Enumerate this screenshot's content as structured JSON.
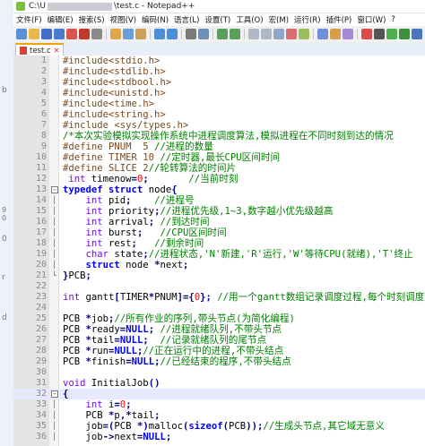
{
  "window": {
    "title_prefix": "C:\\U",
    "title_suffix": "\\test.c - Notepad++",
    "menu": [
      "文件(F)",
      "编辑(E)",
      "搜索(S)",
      "视图(V)",
      "编码(N)",
      "语言(L)",
      "设置(T)",
      "工具(O)",
      "宏(M)",
      "运行(R)",
      "插件(P)",
      "窗口(W)",
      "?"
    ]
  },
  "tab": {
    "label": "test.c"
  },
  "left_strip_marks": [
    "b",
    "9 0",
    "0",
    "r",
    "d"
  ],
  "lines": [
    {
      "n": "1",
      "fold": "",
      "cur": false,
      "seg": [
        [
          "pp",
          "#include<stdio.h>"
        ]
      ]
    },
    {
      "n": "2",
      "fold": "",
      "cur": false,
      "seg": [
        [
          "pp",
          "#include<stdlib.h>"
        ]
      ]
    },
    {
      "n": "3",
      "fold": "",
      "cur": false,
      "seg": [
        [
          "pp",
          "#include<stdbool.h>"
        ]
      ]
    },
    {
      "n": "4",
      "fold": "",
      "cur": false,
      "seg": [
        [
          "pp",
          "#include<unistd.h>"
        ]
      ]
    },
    {
      "n": "5",
      "fold": "",
      "cur": false,
      "seg": [
        [
          "pp",
          "#include<time.h>"
        ]
      ]
    },
    {
      "n": "6",
      "fold": "",
      "cur": false,
      "seg": [
        [
          "pp",
          "#include<string.h>"
        ]
      ]
    },
    {
      "n": "7",
      "fold": "",
      "cur": false,
      "seg": [
        [
          "pp",
          "#include <sys/types.h>"
        ]
      ]
    },
    {
      "n": "8",
      "fold": "",
      "cur": false,
      "seg": [
        [
          "cm",
          "/*本次实验模拟实现操作系统中进程调度算法,模拟进程在不同时刻到达的情况"
        ]
      ]
    },
    {
      "n": "9",
      "fold": "",
      "cur": false,
      "seg": [
        [
          "pp",
          "#define PNUM  5 "
        ],
        [
          "cm",
          "//进程的数量"
        ]
      ]
    },
    {
      "n": "10",
      "fold": "",
      "cur": false,
      "seg": [
        [
          "pp",
          "#define TIMER 10 "
        ],
        [
          "cm",
          "//定时器,最长CPU区间时间"
        ]
      ]
    },
    {
      "n": "11",
      "fold": "",
      "cur": false,
      "seg": [
        [
          "pp",
          "#define SLICE 2"
        ],
        [
          "cm",
          "//轮转算法的时间片"
        ]
      ]
    },
    {
      "n": "12",
      "fold": "",
      "cur": false,
      "seg": [
        [
          "id",
          " "
        ],
        [
          "ty",
          "int"
        ],
        [
          "id",
          " timenow"
        ],
        [
          "op",
          "="
        ],
        [
          "nm",
          "0"
        ],
        [
          "op",
          ";"
        ],
        [
          "cm",
          "       //当前时刻"
        ]
      ]
    },
    {
      "n": "13",
      "fold": "box",
      "cur": false,
      "seg": [
        [
          "kw",
          "typedef"
        ],
        [
          "id",
          " "
        ],
        [
          "kw",
          "struct"
        ],
        [
          "id",
          " node"
        ],
        [
          "op",
          "{"
        ]
      ]
    },
    {
      "n": "14",
      "fold": "line",
      "cur": false,
      "seg": [
        [
          "id",
          "    "
        ],
        [
          "ty",
          "int"
        ],
        [
          "id",
          " pid"
        ],
        [
          "op",
          ";"
        ],
        [
          "cm",
          "    //进程号"
        ]
      ]
    },
    {
      "n": "15",
      "fold": "line",
      "cur": false,
      "seg": [
        [
          "id",
          "    "
        ],
        [
          "ty",
          "int"
        ],
        [
          "id",
          " priority"
        ],
        [
          "op",
          ";"
        ],
        [
          "cm",
          "//进程优先级,1~3,数字越小优先级越高"
        ]
      ]
    },
    {
      "n": "16",
      "fold": "line",
      "cur": false,
      "seg": [
        [
          "id",
          "    "
        ],
        [
          "ty",
          "int"
        ],
        [
          "id",
          " arrival"
        ],
        [
          "op",
          ";"
        ],
        [
          "cm",
          " //到达时间"
        ]
      ]
    },
    {
      "n": "17",
      "fold": "line",
      "cur": false,
      "seg": [
        [
          "id",
          "    "
        ],
        [
          "ty",
          "int"
        ],
        [
          "id",
          " burst"
        ],
        [
          "op",
          ";"
        ],
        [
          "cm",
          "   //CPU区间时间"
        ]
      ]
    },
    {
      "n": "18",
      "fold": "line",
      "cur": false,
      "seg": [
        [
          "id",
          "    "
        ],
        [
          "ty",
          "int"
        ],
        [
          "id",
          " rest"
        ],
        [
          "op",
          ";"
        ],
        [
          "cm",
          "   //剩余时间"
        ]
      ]
    },
    {
      "n": "19",
      "fold": "line",
      "cur": false,
      "seg": [
        [
          "id",
          "    "
        ],
        [
          "ty",
          "char"
        ],
        [
          "id",
          " state"
        ],
        [
          "op",
          ";"
        ],
        [
          "cm",
          "//进程状态,'N'新建,'R'运行,'W'等待CPU(就绪),'T'终止"
        ]
      ]
    },
    {
      "n": "20",
      "fold": "line",
      "cur": false,
      "seg": [
        [
          "id",
          "    "
        ],
        [
          "kw",
          "struct"
        ],
        [
          "id",
          " node "
        ],
        [
          "op",
          "*"
        ],
        [
          "id",
          "next"
        ],
        [
          "op",
          ";"
        ]
      ]
    },
    {
      "n": "21",
      "fold": "end",
      "cur": false,
      "seg": [
        [
          "op",
          "}"
        ],
        [
          "id",
          "PCB"
        ],
        [
          "op",
          ";"
        ]
      ]
    },
    {
      "n": "22",
      "fold": "",
      "cur": false,
      "seg": []
    },
    {
      "n": "23",
      "fold": "",
      "cur": false,
      "seg": [
        [
          "ty",
          "int"
        ],
        [
          "id",
          " gantt"
        ],
        [
          "op",
          "["
        ],
        [
          "id",
          "TIMER"
        ],
        [
          "op",
          "*"
        ],
        [
          "id",
          "PNUM"
        ],
        [
          "op",
          "]={"
        ],
        [
          "nm",
          "0"
        ],
        [
          "op",
          "};"
        ],
        [
          "cm",
          " //用一个gantt数组记录调度过程,每个时刻调度"
        ]
      ]
    },
    {
      "n": "24",
      "fold": "",
      "cur": false,
      "seg": []
    },
    {
      "n": "25",
      "fold": "",
      "cur": false,
      "seg": [
        [
          "id",
          "PCB "
        ],
        [
          "op",
          "*"
        ],
        [
          "id",
          "job"
        ],
        [
          "op",
          ";"
        ],
        [
          "cm",
          "//所有作业的序列,带头节点(为简化编程)"
        ]
      ]
    },
    {
      "n": "26",
      "fold": "",
      "cur": false,
      "seg": [
        [
          "id",
          "PCB "
        ],
        [
          "op",
          "*"
        ],
        [
          "id",
          "ready"
        ],
        [
          "op",
          "="
        ],
        [
          "kw",
          "NULL"
        ],
        [
          "op",
          ";"
        ],
        [
          "cm",
          " //进程就绪队列,不带头节点"
        ]
      ]
    },
    {
      "n": "27",
      "fold": "",
      "cur": false,
      "seg": [
        [
          "id",
          "PCB "
        ],
        [
          "op",
          "*"
        ],
        [
          "id",
          "tail"
        ],
        [
          "op",
          "="
        ],
        [
          "kw",
          "NULL"
        ],
        [
          "op",
          ";"
        ],
        [
          "cm",
          "  //记录就绪队列的尾节点"
        ]
      ]
    },
    {
      "n": "28",
      "fold": "",
      "cur": false,
      "seg": [
        [
          "id",
          "PCB "
        ],
        [
          "op",
          "*"
        ],
        [
          "id",
          "run"
        ],
        [
          "op",
          "="
        ],
        [
          "kw",
          "NULL"
        ],
        [
          "op",
          ";"
        ],
        [
          "cm",
          "//正在运行中的进程,不带头结点"
        ]
      ]
    },
    {
      "n": "29",
      "fold": "",
      "cur": false,
      "seg": [
        [
          "id",
          "PCB "
        ],
        [
          "op",
          "*"
        ],
        [
          "id",
          "finish"
        ],
        [
          "op",
          "="
        ],
        [
          "kw",
          "NULL"
        ],
        [
          "op",
          ";"
        ],
        [
          "cm",
          "//已经结束的程序,不带头结点"
        ]
      ]
    },
    {
      "n": "30",
      "fold": "",
      "cur": false,
      "seg": []
    },
    {
      "n": "31",
      "fold": "",
      "cur": false,
      "seg": [
        [
          "ty",
          "void"
        ],
        [
          "id",
          " InitialJob"
        ],
        [
          "op",
          "()"
        ]
      ]
    },
    {
      "n": "32",
      "fold": "box",
      "cur": true,
      "seg": [
        [
          "op",
          "{"
        ]
      ]
    },
    {
      "n": "33",
      "fold": "line",
      "cur": false,
      "seg": [
        [
          "id",
          "    "
        ],
        [
          "ty",
          "int"
        ],
        [
          "id",
          " i"
        ],
        [
          "op",
          "="
        ],
        [
          "nm",
          "0"
        ],
        [
          "op",
          ";"
        ]
      ]
    },
    {
      "n": "34",
      "fold": "line",
      "cur": false,
      "seg": [
        [
          "id",
          "    PCB "
        ],
        [
          "op",
          "*"
        ],
        [
          "id",
          "p"
        ],
        [
          "op",
          ",*"
        ],
        [
          "id",
          "tail"
        ],
        [
          "op",
          ";"
        ]
      ]
    },
    {
      "n": "35",
      "fold": "line",
      "cur": false,
      "seg": [
        [
          "id",
          "    job"
        ],
        [
          "op",
          "=("
        ],
        [
          "id",
          "PCB "
        ],
        [
          "op",
          "*)"
        ],
        [
          "id",
          "malloc"
        ],
        [
          "op",
          "("
        ],
        [
          "kw",
          "sizeof"
        ],
        [
          "op",
          "("
        ],
        [
          "id",
          "PCB"
        ],
        [
          "op",
          "));"
        ],
        [
          "cm",
          "//生成头节点,其它域无意义"
        ]
      ]
    },
    {
      "n": "36",
      "fold": "line",
      "cur": false,
      "seg": [
        [
          "id",
          "    job"
        ],
        [
          "op",
          "->"
        ],
        [
          "id",
          "next"
        ],
        [
          "op",
          "="
        ],
        [
          "kw",
          "NULL"
        ],
        [
          "op",
          ";"
        ]
      ]
    }
  ]
}
